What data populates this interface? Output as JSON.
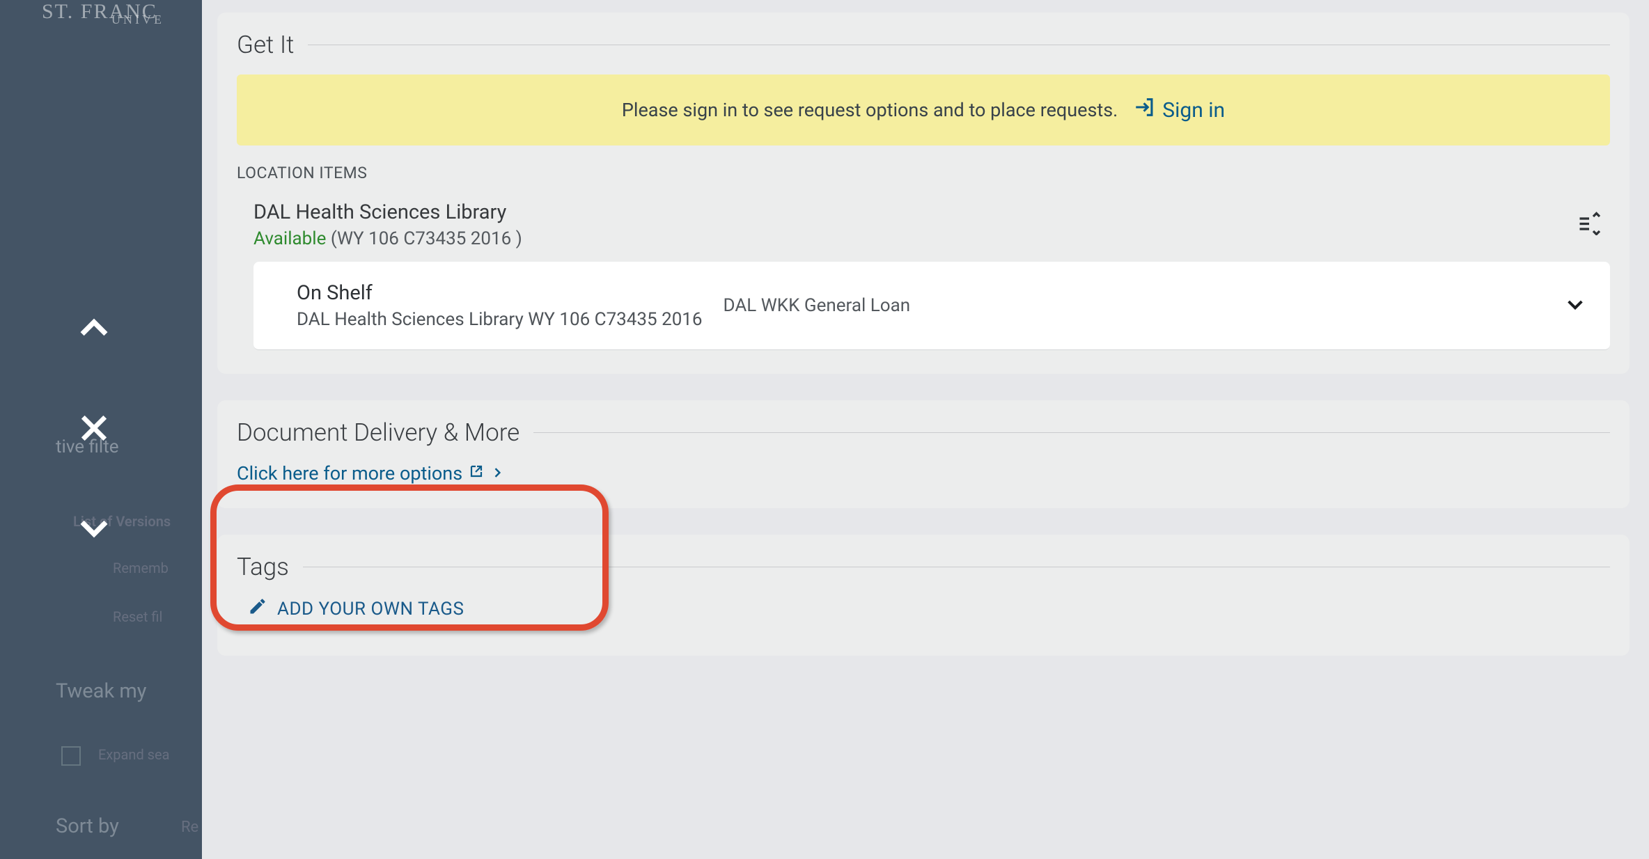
{
  "background": {
    "brand_top": "ST. FRANC",
    "brand_univ": "UNIVE",
    "active_filter": "tive filte",
    "versions": "List of Versions",
    "remember": "Rememb",
    "reset": "Reset fil",
    "tweak": "Tweak my",
    "expand": "Expand sea",
    "sortby": "Sort by",
    "sortval": "Re"
  },
  "get_it": {
    "title": "Get It",
    "banner_text": "Please sign in to see request options and to place requests.",
    "signin_label": "Sign in",
    "location_header": "LOCATION ITEMS",
    "location_name": "DAL Health Sciences Library",
    "availability_status": "Available",
    "call_number": " (WY 106 C73435 2016 )",
    "shelf_status": "On Shelf",
    "shelf_location": "DAL Health Sciences Library WY 106 C73435 2016",
    "loan_type": "DAL WKK General Loan"
  },
  "docdel": {
    "title": "Document Delivery & More",
    "link_text": "Click here for more options"
  },
  "tags": {
    "title": "Tags",
    "add_label": "ADD YOUR OWN TAGS"
  }
}
